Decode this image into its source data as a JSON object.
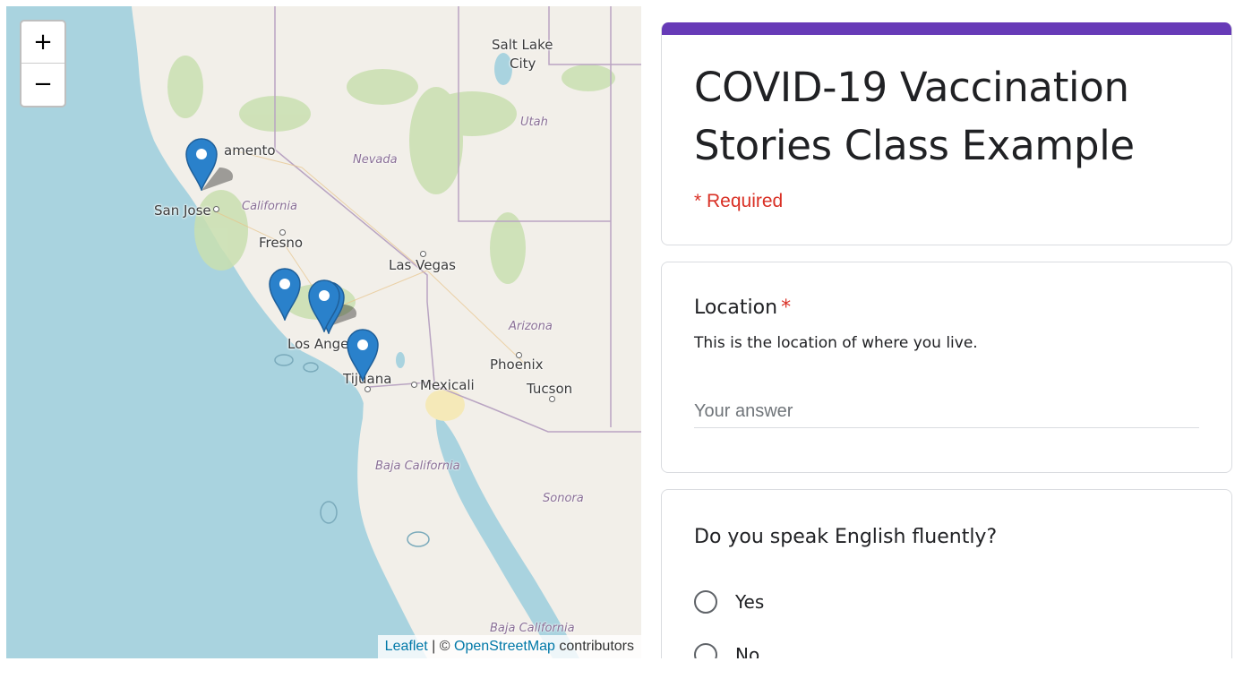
{
  "map": {
    "zoom_in_label": "+",
    "zoom_out_label": "−",
    "places": [
      {
        "name": "Salt Lake",
        "kind": "city"
      },
      {
        "name": "City",
        "kind": "city"
      },
      {
        "name": "Utah",
        "kind": "region"
      },
      {
        "name": "Nevada",
        "kind": "region"
      },
      {
        "name": "amento",
        "kind": "city"
      },
      {
        "name": "San Jose",
        "kind": "city"
      },
      {
        "name": "California",
        "kind": "region"
      },
      {
        "name": "Fresno",
        "kind": "city"
      },
      {
        "name": "Las Vegas",
        "kind": "city"
      },
      {
        "name": "Arizona",
        "kind": "region"
      },
      {
        "name": "Los Ange",
        "kind": "city"
      },
      {
        "name": "Phoenix",
        "kind": "city"
      },
      {
        "name": "Tijuana",
        "kind": "city"
      },
      {
        "name": "Mexicali",
        "kind": "city"
      },
      {
        "name": "Tucson",
        "kind": "city"
      },
      {
        "name": "Baja California",
        "kind": "region"
      },
      {
        "name": "Sonora",
        "kind": "region"
      },
      {
        "name": "Baja California",
        "kind": "region"
      }
    ],
    "marker_count": 5,
    "marker_color": "#2a81cb",
    "attribution": {
      "leaflet_link": "Leaflet",
      "separator": " | © ",
      "osm_link": "OpenStreetMap",
      "suffix": " contributors"
    }
  },
  "form": {
    "accent_color": "#673ab7",
    "title": "COVID-19 Vaccination Stories Class Example",
    "required_note": "* Required",
    "questions": [
      {
        "title": "Location",
        "required_mark": "*",
        "description": "This is the location of where you live.",
        "placeholder": "Your answer"
      },
      {
        "title": "Do you speak English fluently?",
        "options": [
          "Yes",
          "No"
        ]
      }
    ]
  }
}
